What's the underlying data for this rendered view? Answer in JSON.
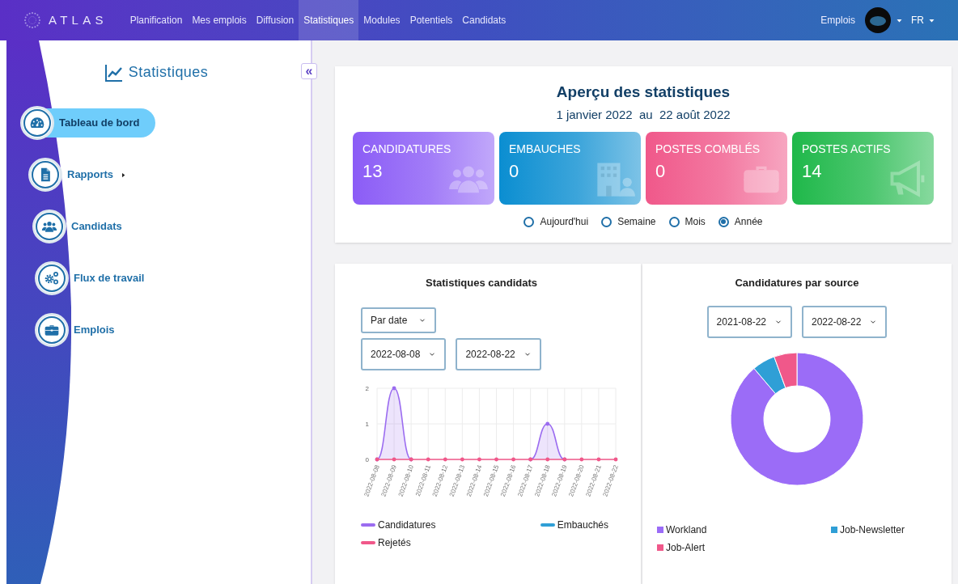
{
  "navbar": {
    "logo": "ATLAS",
    "items": [
      {
        "label": "Planification",
        "selected": false
      },
      {
        "label": "Mes emplois",
        "selected": false
      },
      {
        "label": "Diffusion",
        "selected": false
      },
      {
        "label": "Statistiques",
        "selected": true
      },
      {
        "label": "Modules",
        "selected": false
      },
      {
        "label": "Potentiels",
        "selected": false
      },
      {
        "label": "Candidats",
        "selected": false
      }
    ],
    "right_link": "Emplois",
    "language": "FR"
  },
  "sidebar": {
    "title": "Statistiques",
    "collapse": "«",
    "items": [
      {
        "label": "Tableau de bord",
        "kind": "dashboard",
        "selected": true,
        "submenu": false
      },
      {
        "label": "Rapports",
        "kind": "document",
        "selected": false,
        "submenu": true
      },
      {
        "label": "Candidats",
        "kind": "people",
        "selected": false,
        "submenu": false
      },
      {
        "label": "Flux de travail",
        "kind": "gears",
        "selected": false,
        "submenu": false
      },
      {
        "label": "Emplois",
        "kind": "briefcase",
        "selected": false,
        "submenu": false
      }
    ]
  },
  "overview": {
    "title": "Aperçu des statistiques",
    "period": "1 janvier 2022  au  22 août 2022",
    "cards": [
      {
        "label": "CANDIDATURES",
        "value": "13",
        "kind": "people",
        "color": "#8b5cf6"
      },
      {
        "label": "EMBAUCHES",
        "value": "0",
        "kind": "building",
        "color": "#0b8ed1"
      },
      {
        "label": "POSTES COMBLÉS",
        "value": "0",
        "kind": "briefcase",
        "color": "#f0588a"
      },
      {
        "label": "POSTES ACTIFS",
        "value": "14",
        "kind": "megaphone",
        "color": "#1fb84a"
      }
    ],
    "periods": [
      {
        "label": "Aujourd'hui",
        "selected": false
      },
      {
        "label": "Semaine",
        "selected": false
      },
      {
        "label": "Mois",
        "selected": false
      },
      {
        "label": "Année",
        "selected": true
      }
    ]
  },
  "candidate_stats": {
    "title": "Statistiques candidats",
    "group_by": "Par date",
    "start_date": "2022-08-08",
    "end_date": "2022-08-22",
    "chart_data": {
      "type": "line",
      "categories": [
        "2022-08-08",
        "2022-08-09",
        "2022-08-10",
        "2022-08-11",
        "2022-08-12",
        "2022-08-13",
        "2022-08-14",
        "2022-08-15",
        "2022-08-16",
        "2022-08-17",
        "2022-08-18",
        "2022-08-19",
        "2022-08-20",
        "2022-08-21",
        "2022-08-22"
      ],
      "yticks": [
        0,
        1,
        2
      ],
      "ylim": [
        0,
        2
      ],
      "grid": true,
      "series": [
        {
          "name": "Candidatures",
          "color": "#9b6cf0",
          "values": [
            0,
            2,
            0,
            null,
            null,
            null,
            null,
            null,
            null,
            0,
            1,
            0,
            null,
            null,
            null
          ]
        },
        {
          "name": "Embauchés",
          "color": "#2f9fd6",
          "values": [
            null,
            null,
            null,
            null,
            null,
            null,
            null,
            null,
            null,
            null,
            null,
            null,
            null,
            null,
            null
          ]
        },
        {
          "name": "Rejetés",
          "color": "#f0588a",
          "values": [
            0,
            0,
            0,
            0,
            0,
            0,
            0,
            0,
            0,
            0,
            0,
            0,
            0,
            0,
            0
          ]
        }
      ]
    }
  },
  "source_stats": {
    "title": "Candidatures par source",
    "start_date": "2021-08-22",
    "end_date": "2022-08-22",
    "legend": [
      {
        "label": "Workland",
        "color": "#9b6cf7"
      },
      {
        "label": "Job-Newsletter",
        "color": "#2f9fd6"
      },
      {
        "label": "Job-Alert",
        "color": "#f0588a"
      }
    ]
  }
}
